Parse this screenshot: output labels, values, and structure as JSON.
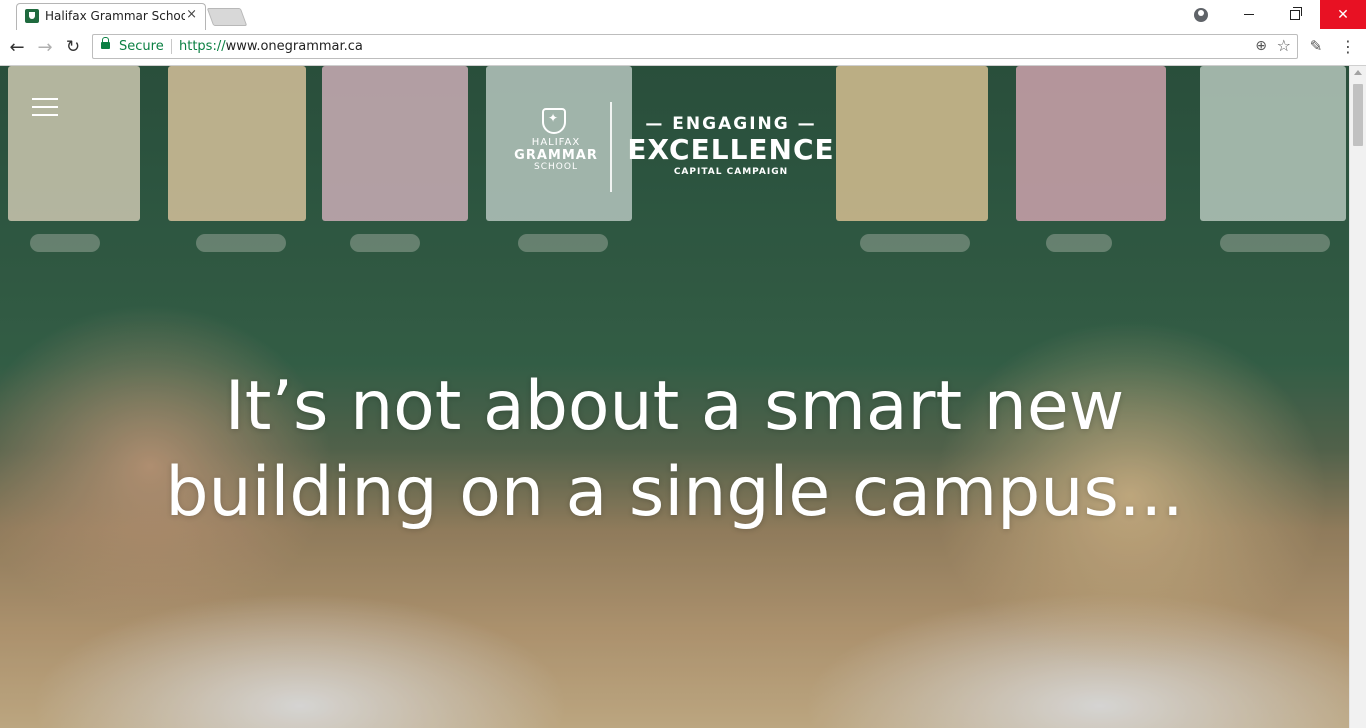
{
  "browser": {
    "tab_title": "Halifax Grammar School",
    "tab_close": "×",
    "secure_label": "Secure",
    "url_scheme": "https://",
    "url_host": "www.onegrammar.ca",
    "window_close": "✕",
    "brand_color": "#e81123",
    "secure_color": "#0b8043"
  },
  "page": {
    "logo": {
      "school_line1": "HALIFAX",
      "school_line2": "GRAMMAR",
      "school_line3": "SCHOOL",
      "campaign_line1": "— ENGAGING —",
      "campaign_line2": "EXCELLENCE",
      "campaign_line3": "CAPITAL CAMPAIGN"
    },
    "headline_line1": "It’s not about a smart new",
    "headline_line2": "building on a single campus..."
  },
  "icons": [
    "profile-icon",
    "minimize-icon",
    "maximize-icon",
    "close-icon",
    "back-arrow-icon",
    "forward-arrow-icon",
    "reload-icon",
    "lock-icon",
    "zoom-icon",
    "star-icon",
    "eyedropper-icon",
    "kebab-menu-icon",
    "hamburger-menu-icon",
    "crest-icon"
  ]
}
